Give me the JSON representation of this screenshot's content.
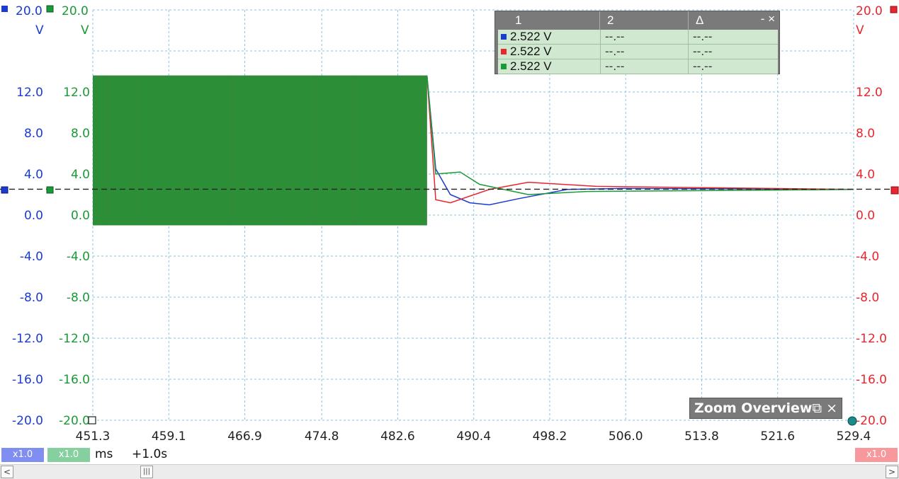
{
  "channels": {
    "blue": {
      "color": "#1a3ccf",
      "range_top": "20.0",
      "unit": "V"
    },
    "green": {
      "color": "#1a9a36",
      "range_top": "20.0",
      "unit": "V"
    },
    "red": {
      "color": "#e8262f",
      "range_top": "20.0",
      "unit": "V"
    }
  },
  "y_ticks_left_blue": [
    "12.0",
    "8.0",
    "4.0",
    "0.0",
    "-4.0",
    "-8.0",
    "-12.0",
    "-16.0",
    "-20.0"
  ],
  "y_ticks_left_green": [
    "12.0",
    "8.0",
    "4.0",
    "0.0",
    "-4.0",
    "-8.0",
    "-12.0",
    "-16.0",
    "-20.0"
  ],
  "y_ticks_right_red": [
    "12.0",
    "8.0",
    "4.0",
    "0.0",
    "-4.0",
    "-8.0",
    "-12.0",
    "-16.0",
    "-20.0"
  ],
  "x_ticks": [
    "451.3",
    "459.1",
    "466.9",
    "474.8",
    "482.6",
    "490.4",
    "498.2",
    "506.0",
    "513.8",
    "521.6",
    "529.4"
  ],
  "cursor_table": {
    "headers": [
      "1",
      "2",
      "Δ"
    ],
    "controls": "- ×",
    "rows": [
      {
        "channel": "blue",
        "color": "#1a3ccf",
        "v1": "2.522 V",
        "v2": "--.--",
        "v3": "--.--"
      },
      {
        "channel": "red",
        "color": "#e8262f",
        "v1": "2.522 V",
        "v2": "--.--",
        "v3": "--.--"
      },
      {
        "channel": "green",
        "color": "#1a9a36",
        "v1": "2.522 V",
        "v2": "--.--",
        "v3": "--.--"
      }
    ]
  },
  "zoom_overview": {
    "title": "Zoom Overview",
    "controls": "⧉ ×"
  },
  "bottom_bar": {
    "blue_scale": "x1.0",
    "green_scale": "x1.0",
    "red_scale": "x1.0",
    "time_unit": "ms",
    "time_offset": "+1.0s"
  },
  "trigger_level_v": 2.522,
  "chart_data": {
    "type": "line",
    "x_unit": "ms",
    "xlim": [
      451.3,
      529.4
    ],
    "ylim": [
      -20.0,
      20.0
    ],
    "grid": true,
    "series": [
      {
        "name": "",
        "color": "#1a3ccf",
        "x": [
          451.3,
          456.0,
          460.9,
          470.2,
          475.5,
          485.6,
          486.5,
          488.0,
          490.0,
          492.0,
          495.0,
          500.0,
          506.0,
          529.4
        ],
        "y": [
          13.6,
          13.6,
          0.5,
          13.6,
          0.5,
          13.6,
          4.5,
          2.0,
          1.2,
          1.0,
          1.6,
          2.5,
          2.6,
          2.5
        ]
      },
      {
        "name": "",
        "color": "#e8262f",
        "x": [
          451.3,
          456.0,
          460.9,
          465.5,
          470.2,
          475.5,
          480.6,
          485.6,
          486.5,
          488.0,
          492.0,
          496.0,
          503.0,
          529.4
        ],
        "y": [
          0.5,
          0.5,
          13.6,
          0.5,
          0.5,
          13.6,
          0.5,
          13.6,
          1.5,
          1.2,
          2.5,
          3.2,
          2.8,
          2.5
        ]
      },
      {
        "name": "",
        "color": "#1a9a36",
        "x": [
          451.3,
          452.8,
          456.0,
          465.5,
          470.2,
          474.0,
          478.0,
          485.6,
          486.5,
          489.0,
          491.0,
          496.0,
          502.0,
          529.4
        ],
        "y": [
          0.5,
          13.6,
          5.0,
          13.6,
          0.5,
          13.6,
          5.0,
          13.6,
          4.0,
          4.2,
          3.0,
          2.0,
          2.3,
          2.5
        ]
      }
    ]
  }
}
